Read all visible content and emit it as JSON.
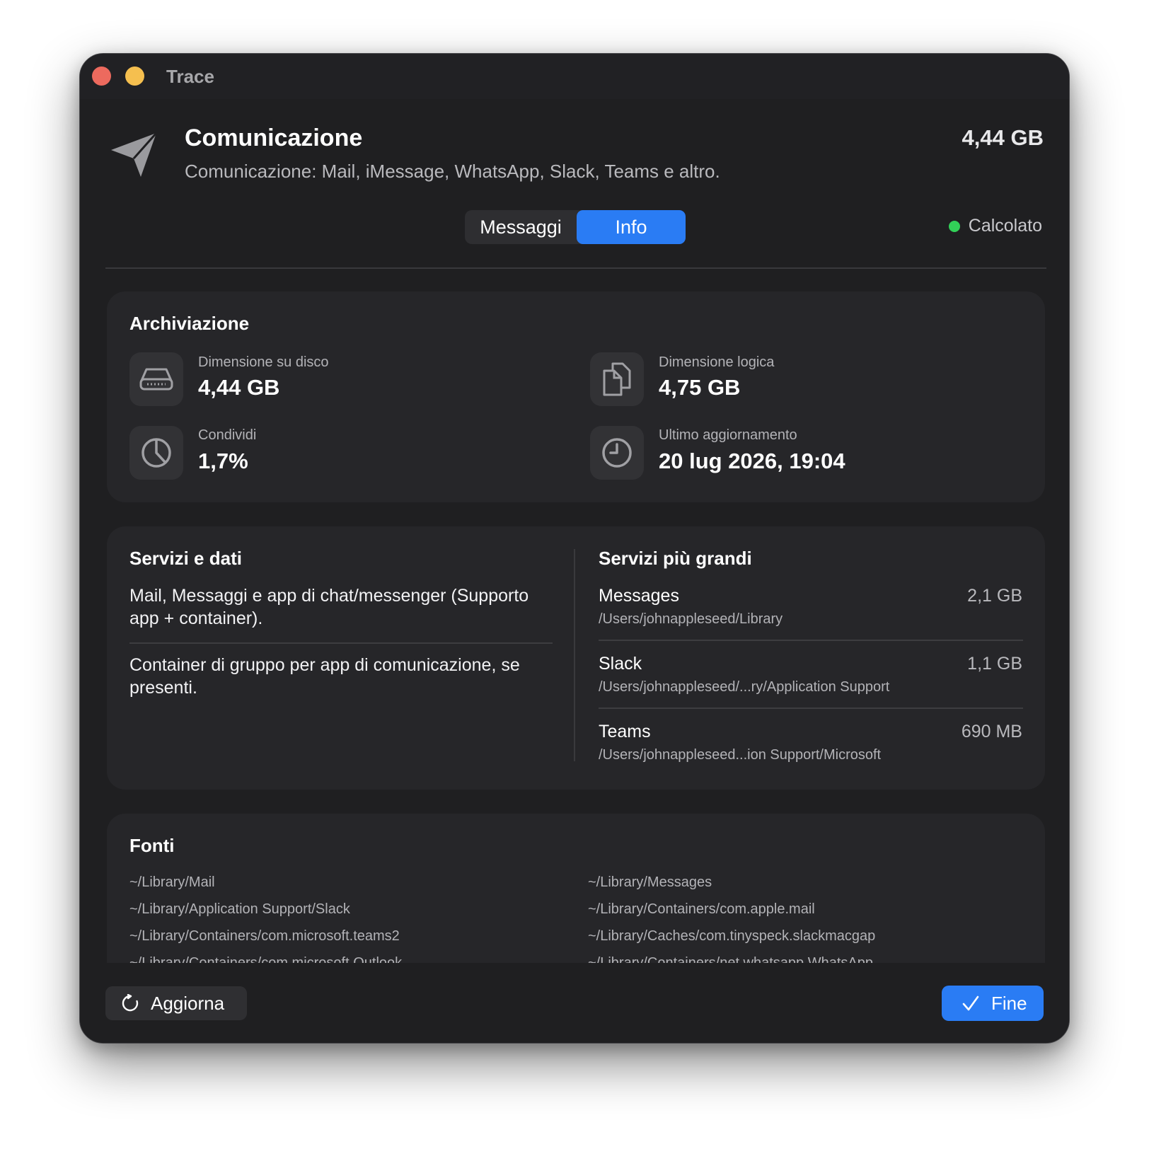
{
  "window": {
    "title": "Trace"
  },
  "header": {
    "icon": "paperplane-icon",
    "title": "Comunicazione",
    "subtitle": "Comunicazione: Mail, iMessage, WhatsApp, Slack, Teams e altro.",
    "size": "4,44 GB"
  },
  "tabs": [
    {
      "label": "Messaggi",
      "selected": false
    },
    {
      "label": "Info",
      "selected": true
    }
  ],
  "status": {
    "label": "Calcolato",
    "color": "#32d158"
  },
  "archiviazione": {
    "title": "Archiviazione",
    "stats": [
      {
        "icon": "disk-icon",
        "label": "Dimensione su disco",
        "value": "4,44 GB"
      },
      {
        "icon": "documents-icon",
        "label": "Dimensione logica",
        "value": "4,75 GB"
      },
      {
        "icon": "pie-chart-icon",
        "label": "Condividi",
        "value": "1,7%"
      },
      {
        "icon": "clock-icon",
        "label": "Ultimo aggiornamento",
        "value": "20 lug 2026, 19:04"
      }
    ]
  },
  "servizi": {
    "title": "Servizi e dati",
    "paragraphs": [
      "Mail, Messaggi e app di chat/messenger (Supporto app + container).",
      "Container di gruppo per app di comunicazione, se presenti."
    ]
  },
  "servizi_grandi": {
    "title": "Servizi più grandi",
    "items": [
      {
        "name": "Messages",
        "path": "/Users/johnappleseed/Library",
        "size": "2,1 GB"
      },
      {
        "name": "Slack",
        "path": "/Users/johnappleseed/...ry/Application Support",
        "size": "1,1 GB"
      },
      {
        "name": "Teams",
        "path": "/Users/johnappleseed...ion Support/Microsoft",
        "size": "690 MB"
      }
    ]
  },
  "fonti": {
    "title": "Fonti",
    "left": [
      "~/Library/Mail",
      "~/Library/Application Support/Slack",
      "~/Library/Containers/com.microsoft.teams2",
      "~/Library/Containers/com.microsoft.Outlook"
    ],
    "right": [
      "~/Library/Messages",
      "~/Library/Containers/com.apple.mail",
      "~/Library/Caches/com.tinyspeck.slackmacgap",
      "~/Library/Containers/net.whatsapp.WhatsApp"
    ]
  },
  "footer": {
    "refresh_label": "Aggiorna",
    "refresh_icon": "refresh-icon",
    "done_label": "Fine",
    "done_icon": "checkmark-icon"
  },
  "colors": {
    "accent": "#2a7cf4",
    "window_bg": "#1f1f21",
    "card_bg": "#262629"
  }
}
